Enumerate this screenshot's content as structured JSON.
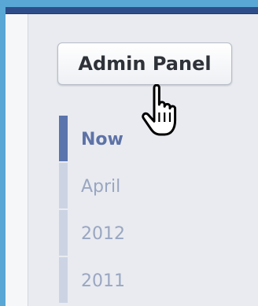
{
  "admin_button": {
    "label": "Admin Panel"
  },
  "timeline": {
    "items": [
      {
        "label": "Now",
        "active": true
      },
      {
        "label": "April",
        "active": false
      },
      {
        "label": "2012",
        "active": false
      },
      {
        "label": "2011",
        "active": false
      }
    ]
  },
  "icons": {
    "cursor": "hand-pointer-icon"
  },
  "colors": {
    "frame": "#59a7d4",
    "topbar": "#2d4d8a",
    "active_accent": "#5b74ad",
    "inactive_accent": "#ccd4e4"
  }
}
